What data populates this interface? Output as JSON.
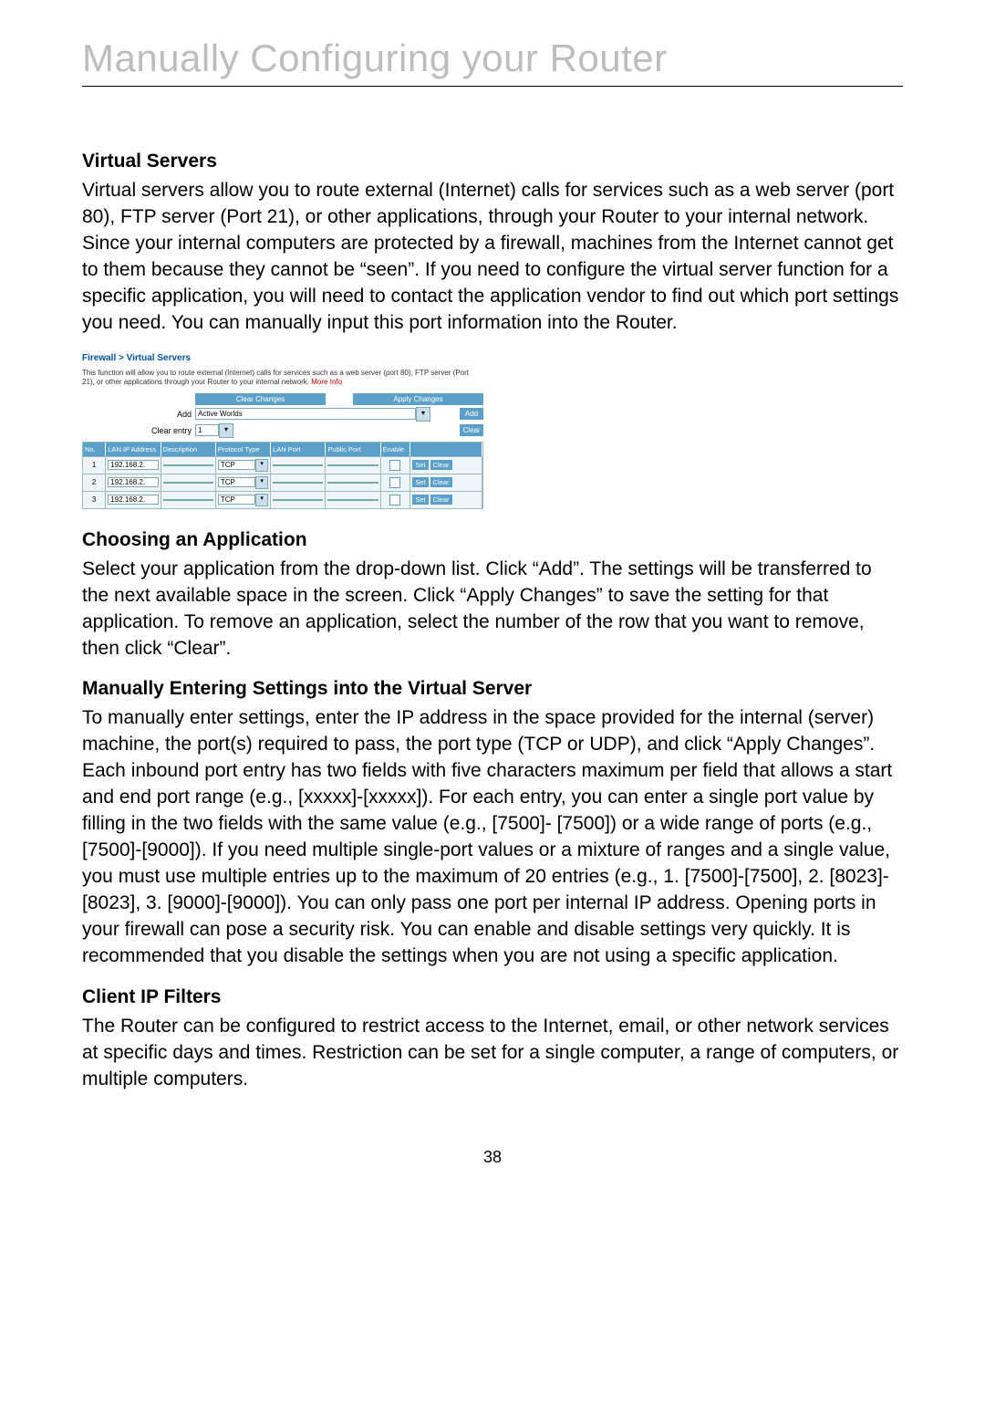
{
  "page_number": "38",
  "header_title": "Manually Configuring your Router",
  "sections": {
    "virtual_servers": {
      "h": "Virtual Servers",
      "p": "Virtual servers allow you to route external (Internet) calls for services such as a web server (port 80), FTP server (Port 21), or other applications, through your Router to your internal network. Since your internal computers are protected by a firewall, machines from the Internet cannot get to them because they cannot be “seen”. If you need to configure the virtual server function for a specific application, you will need to contact the application vendor to find out which port settings you need. You can manually input this port information into the Router."
    },
    "choosing": {
      "h": "Choosing an Application",
      "p": "Select your application from the drop-down list. Click “Add”. The settings will be transferred to the next available space in the screen. Click “Apply Changes” to save the setting for that application. To remove an application, select the number of the row that you want to remove, then click “Clear”."
    },
    "manual": {
      "h": "Manually Entering Settings into the Virtual Server",
      "p": "To manually enter settings, enter the IP address in the space provided for the internal (server) machine, the port(s) required to pass, the port type (TCP or UDP), and click “Apply Changes”. Each inbound port entry has two fields with five characters maximum per field that allows a start and end port range (e.g., [xxxxx]-[xxxxx]). For each entry, you can enter a single port value by filling in the two fields with the same value (e.g., [7500]- [7500]) or a wide range of ports (e.g., [7500]-[9000]). If you need multiple single-port values or a mixture of ranges and a single value, you must use multiple entries up to the maximum of 20 entries (e.g., 1. [7500]-[7500], 2. [8023]-[8023], 3. [9000]-[9000]). You can only pass one port per internal IP address. Opening ports in your firewall can pose a security risk. You can enable and disable settings very quickly. It is recommended that you disable the settings when you are not using a specific application."
    },
    "client_ip": {
      "h": "Client IP Filters",
      "p": "The Router can be configured to restrict access to the Internet, email, or other network services at specific days and times. Restriction can be set for a single computer, a range of computers, or multiple computers."
    }
  },
  "router_ui": {
    "breadcrumb": "Firewall > Virtual Servers",
    "blurb": "This function will allow you to route external (Internet) calls for services such as a web server (port 80), FTP server (Port 21), or other applications through your Router to your internal network.",
    "more_info": "More Info",
    "buttons": {
      "clear_changes": "Clear Changes",
      "apply_changes": "Apply Changes",
      "add": "Add",
      "clear": "Clear",
      "set": "Set",
      "clear_row": "Clear"
    },
    "labels": {
      "add": "Add",
      "clear_entry": "Clear entry"
    },
    "add_value": "Active Worlds",
    "clear_entry_value": "1",
    "columns": {
      "no": "No.",
      "ip": "LAN IP Address",
      "desc": "Description",
      "prot": "Protocol Type",
      "lan": "LAN Port",
      "pub": "Public Port",
      "en": "Enable"
    },
    "rows": [
      {
        "no": "1",
        "ip": "192.168.2.",
        "protocol": "TCP"
      },
      {
        "no": "2",
        "ip": "192.168.2.",
        "protocol": "TCP"
      },
      {
        "no": "3",
        "ip": "192.168.2.",
        "protocol": "TCP"
      }
    ]
  }
}
